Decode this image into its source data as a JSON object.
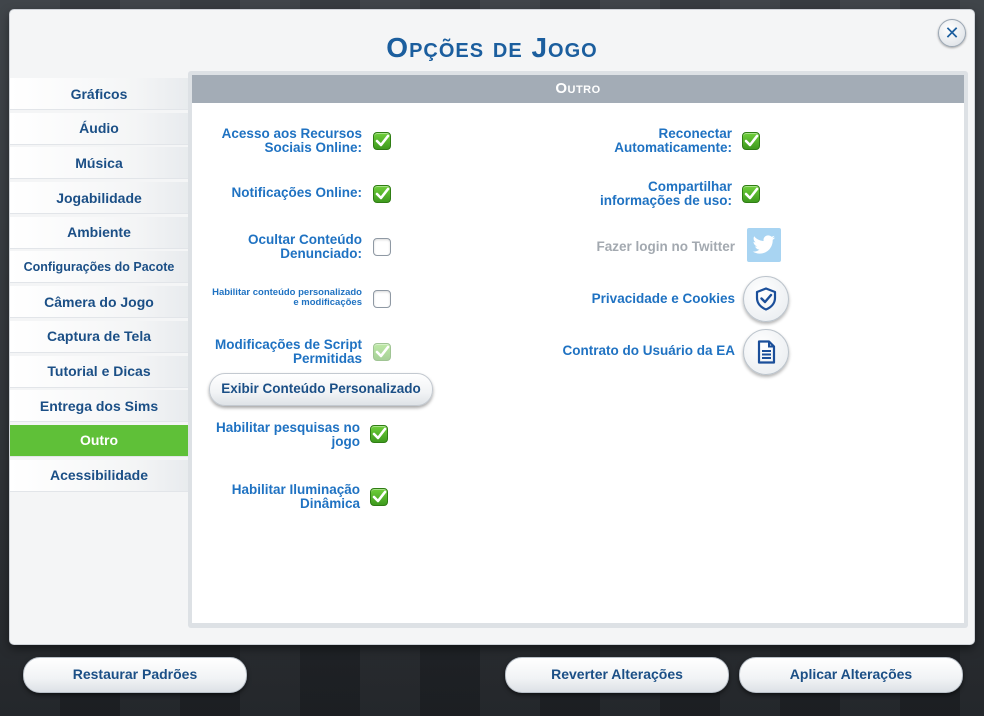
{
  "dialog": {
    "title": "Opções de Jogo",
    "close_icon": "close-x-icon"
  },
  "sidebar": {
    "items": [
      {
        "label": "Gráficos",
        "active": false
      },
      {
        "label": "Áudio",
        "active": false
      },
      {
        "label": "Música",
        "active": false
      },
      {
        "label": "Jogabilidade",
        "active": false
      },
      {
        "label": "Ambiente",
        "active": false
      },
      {
        "label": "Configurações do Pacote",
        "active": false
      },
      {
        "label": "Câmera do Jogo",
        "active": false
      },
      {
        "label": "Captura de Tela",
        "active": false
      },
      {
        "label": "Tutorial e Dicas",
        "active": false
      },
      {
        "label": "Entrega dos Sims",
        "active": false
      },
      {
        "label": "Outro",
        "active": true
      },
      {
        "label": "Acessibilidade",
        "active": false
      }
    ]
  },
  "panel": {
    "header": "Outro",
    "left_options": [
      {
        "label": "Acesso aos Recursos Sociais Online:",
        "checked": true,
        "enabled": true
      },
      {
        "label": "Notificações Online:",
        "checked": true,
        "enabled": true
      },
      {
        "label": "Ocultar Conteúdo Denunciado:",
        "checked": false,
        "enabled": true
      },
      {
        "label": "Habilitar conteúdo personalizado e modificações",
        "checked": false,
        "enabled": true
      },
      {
        "label": "Modificações de Script Permitidas",
        "checked": true,
        "enabled": false
      },
      {
        "label": "Habilitar pesquisas no jogo",
        "checked": true,
        "enabled": true
      },
      {
        "label": "Habilitar Iluminação Dinâmica",
        "checked": true,
        "enabled": true
      }
    ],
    "custom_content_button": "Exibir Conteúdo Personalizado",
    "right_options": [
      {
        "label": "Reconectar Automaticamente:",
        "checked": true
      },
      {
        "label": "Compartilhar informações de uso:",
        "checked": true
      }
    ],
    "twitter": {
      "label": "Fazer login no Twitter",
      "icon": "twitter-bird-icon"
    },
    "privacy": {
      "label": "Privacidade e Cookies",
      "icon": "shield-check-icon"
    },
    "user_agreement": {
      "label": "Contrato do Usuário da EA",
      "icon": "document-icon"
    }
  },
  "footer": {
    "restore_defaults": "Restaurar Padrões",
    "revert_changes": "Reverter Alterações",
    "apply_changes": "Aplicar Alterações"
  },
  "colors": {
    "accent_blue": "#1f72c2",
    "active_green": "#5fc038",
    "header_gray": "#a3acb6"
  }
}
